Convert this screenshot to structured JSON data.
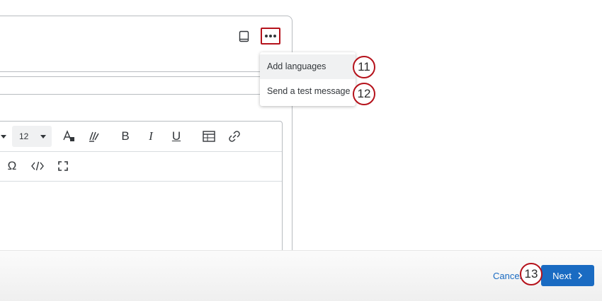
{
  "header": {
    "book_icon": "book-icon",
    "more_icon": "more-horizontal-icon"
  },
  "toolbar": {
    "font_size": "12",
    "tools_row1": [
      "text-color-icon",
      "highlight-icon",
      "bold-icon",
      "italic-icon",
      "underline-icon",
      "table-icon",
      "link-icon"
    ],
    "tools_row2": [
      "special-character-icon",
      "source-code-icon",
      "fullscreen-icon"
    ],
    "bold": "B",
    "italic": "I",
    "underline": "U",
    "omega": "Ω"
  },
  "dropdown": {
    "items": [
      {
        "label": "Add languages",
        "callout": "11"
      },
      {
        "label": "Send a test message",
        "callout": "12"
      }
    ]
  },
  "footer": {
    "cancel_label": "Cancel",
    "next_label": "Next",
    "callout": "13"
  },
  "colors": {
    "callout_border": "#b5121b",
    "primary": "#1a6bc2"
  }
}
